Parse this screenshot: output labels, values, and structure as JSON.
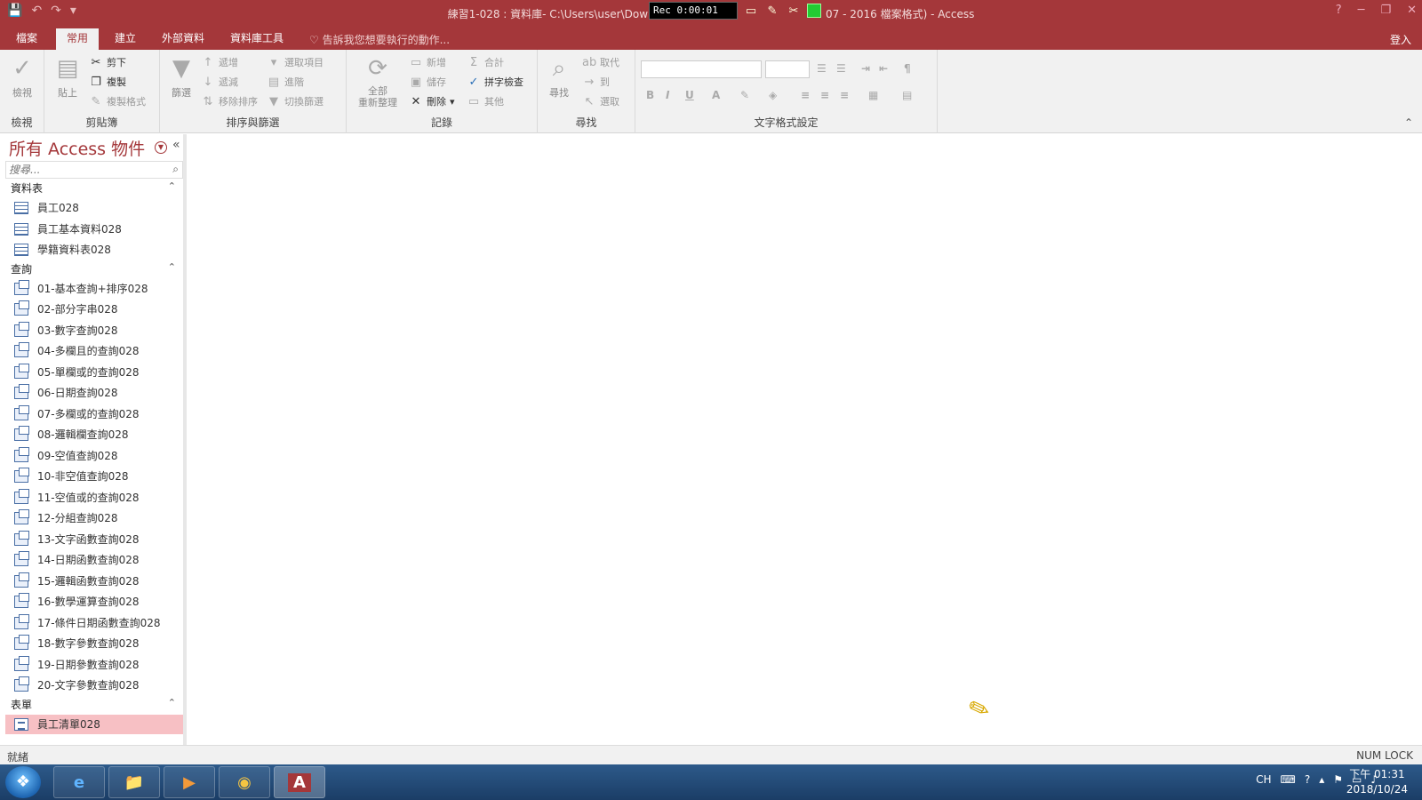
{
  "titlebar": {
    "qat": [
      "💾",
      "↶",
      "↷",
      "▾"
    ],
    "title": "練習1-028 : 資料庫- C:\\Users\\user\\Dow",
    "title_suffix": "07 - 2016 檔案格式) - Access",
    "rec_time": "Rec 0:00:01",
    "help": "?",
    "minimize": "─",
    "restore": "❐",
    "close": "✕"
  },
  "tabs": [
    {
      "label": "檔案"
    },
    {
      "label": "常用",
      "active": true
    },
    {
      "label": "建立"
    },
    {
      "label": "外部資料"
    },
    {
      "label": "資料庫工具"
    }
  ],
  "tell_me": "告訴我您想要執行的動作...",
  "sign_in": "登入",
  "ribbon": {
    "views": {
      "view_label": "檢視",
      "group": "檢視"
    },
    "clipboard": {
      "paste": "貼上",
      "cut": "剪下",
      "copy": "複製",
      "format_painter": "複製格式",
      "group": "剪貼簿"
    },
    "sort_filter": {
      "filter": "篩選",
      "ascending": "遞增",
      "descending": "遞減",
      "remove_sort": "移除排序",
      "selection": "選取項目",
      "advanced": "進階",
      "toggle_filter": "切換篩選",
      "group": "排序與篩選"
    },
    "records": {
      "refresh_all": "全部\n重新整理",
      "new": "新增",
      "save": "儲存",
      "delete": "刪除",
      "totals": "合計",
      "spelling": "拼字檢查",
      "more": "其他",
      "group": "記錄"
    },
    "find": {
      "find": "尋找",
      "replace": "取代",
      "goto": "到",
      "select": "選取",
      "group": "尋找"
    },
    "text_format": {
      "group": "文字格式設定"
    }
  },
  "nav": {
    "title": "所有 Access 物件",
    "search_placeholder": "搜尋...",
    "sections": {
      "tables": {
        "label": "資料表",
        "items": [
          "員工028",
          "員工基本資料028",
          "學籍資料表028"
        ]
      },
      "queries": {
        "label": "查詢",
        "items": [
          "01-基本查詢+排序028",
          "02-部分字串028",
          "03-數字查詢028",
          "04-多欄且的查詢028",
          "05-單欄或的查詢028",
          "06-日期查詢028",
          "07-多欄或的查詢028",
          "08-邏輯欄查詢028",
          "09-空值查詢028",
          "10-非空值查詢028",
          "11-空值或的查詢028",
          "12-分組查詢028",
          "13-文字函數查詢028",
          "14-日期函數查詢028",
          "15-邏輯函數查詢028",
          "16-數學運算查詢028",
          "17-條件日期函數查詢028",
          "18-數字參數查詢028",
          "19-日期參數查詢028",
          "20-文字參數查詢028"
        ]
      },
      "forms": {
        "label": "表單",
        "items": [
          "員工清單028"
        ]
      }
    }
  },
  "status": {
    "left": "就緒",
    "right": "NUM LOCK"
  },
  "taskbar": {
    "apps": [
      {
        "name": "ie",
        "glyph": "e"
      },
      {
        "name": "explorer",
        "glyph": "📁"
      },
      {
        "name": "media",
        "glyph": "▶"
      },
      {
        "name": "chrome",
        "glyph": "◉"
      },
      {
        "name": "access",
        "glyph": "A"
      }
    ],
    "tray_lang": "CH",
    "clock_time": "下午 01:31",
    "clock_date": "2018/10/24"
  }
}
